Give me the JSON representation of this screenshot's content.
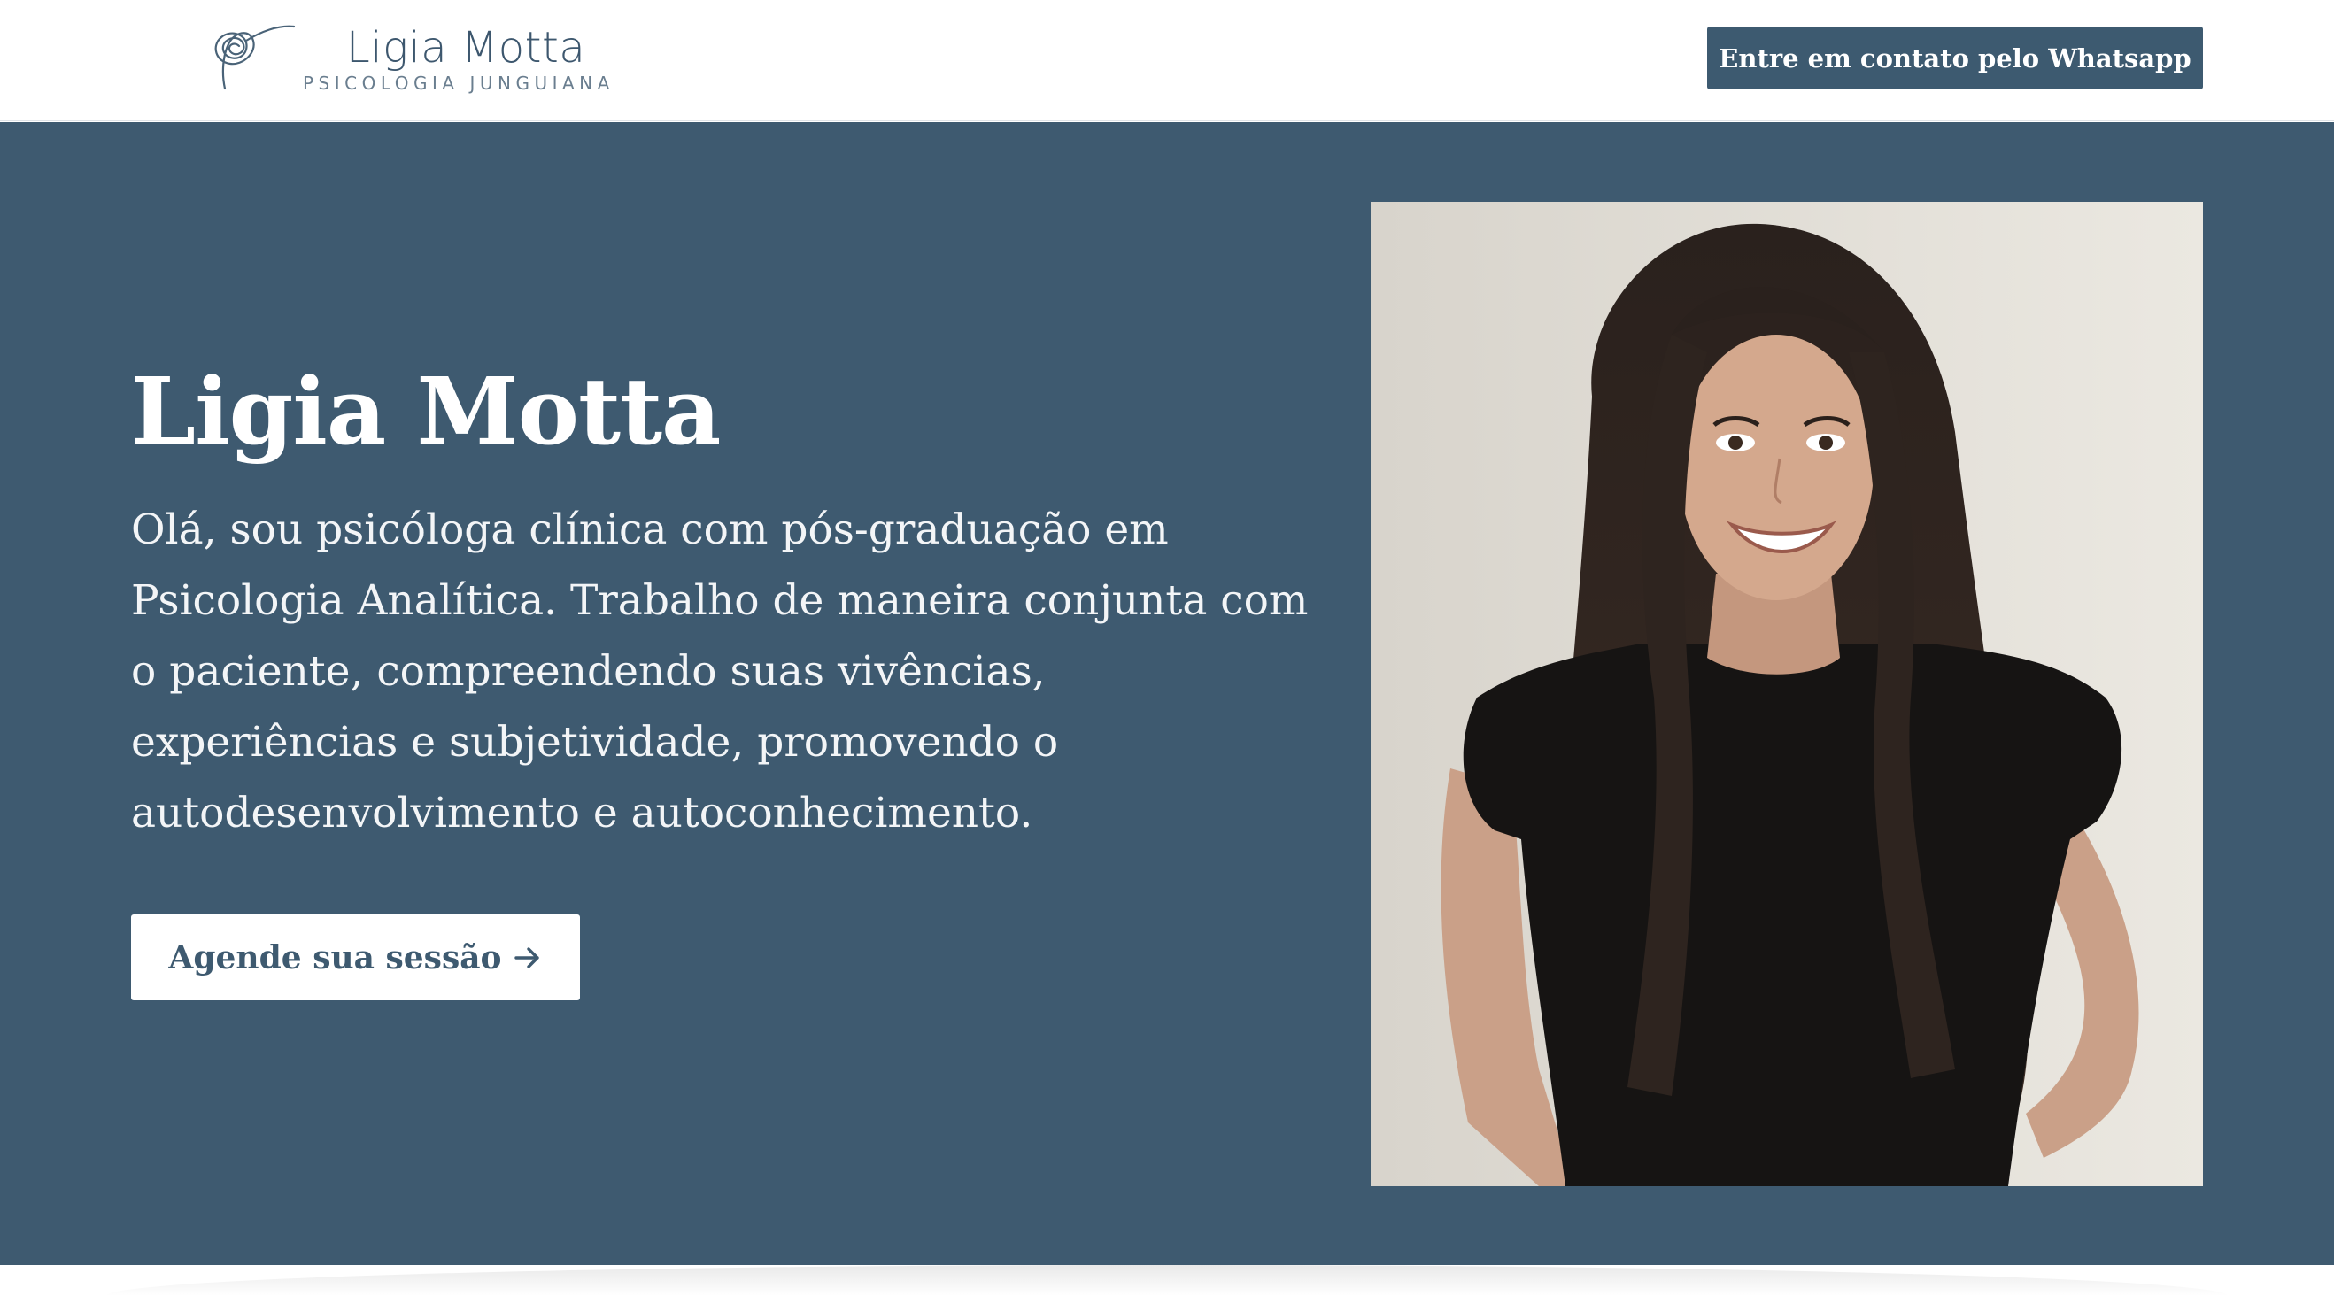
{
  "header": {
    "logo_name": "Ligia Motta",
    "logo_tagline": "PSICOLOGIA JUNGUIANA",
    "whatsapp_label": "Entre em contato pelo Whatsapp"
  },
  "hero": {
    "title": "Ligia Motta",
    "description": "Olá, sou psicóloga clínica com pós-graduação em Psicologia Analítica. Trabalho de maneira conjunta com o paciente, compreendendo suas vivências, experiências e subjetividade, promovendo o autodesenvolvimento e autoconhecimento.",
    "cta_label": "Agende sua sessão",
    "cta_icon": "arrow-right-icon",
    "portrait_icon": "portrait-photo"
  },
  "colors": {
    "brand": "#3e5a70",
    "button_dark": "#3d5a70",
    "text_light": "#ffffff",
    "logo_text": "#3d576e"
  }
}
